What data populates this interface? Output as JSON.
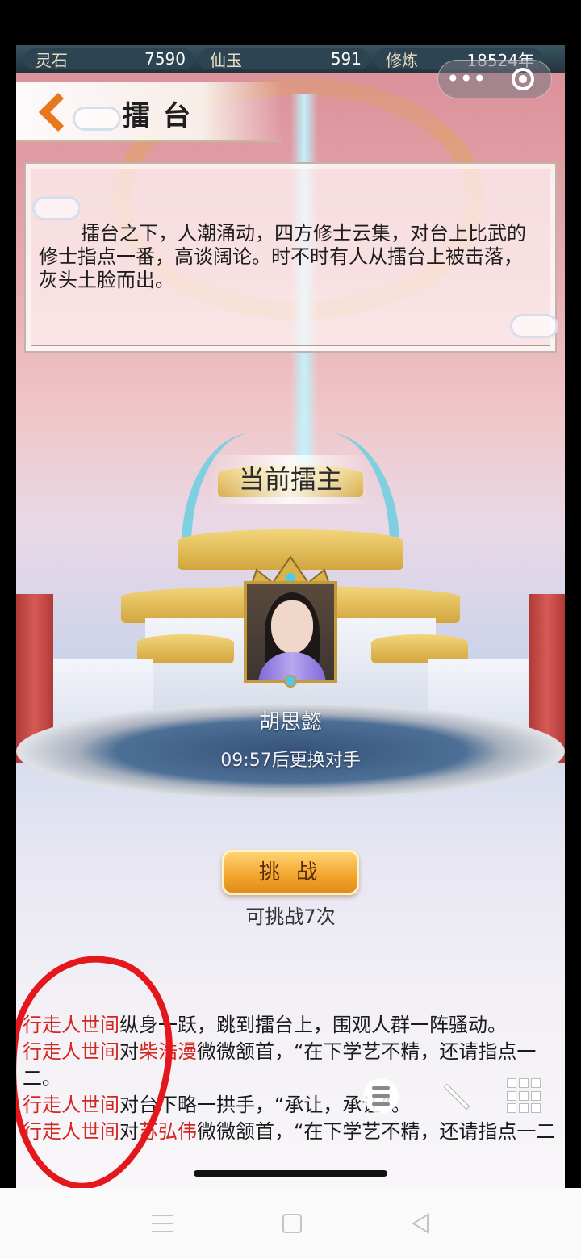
{
  "resources": [
    {
      "label": "灵石",
      "value": "7590"
    },
    {
      "label": "仙玉",
      "value": "591"
    },
    {
      "label": "修炼",
      "value": "18524年"
    }
  ],
  "capsule": {
    "more_icon": "more-dots-icon",
    "close_icon": "target-close-icon"
  },
  "header": {
    "title": "擂台",
    "back_icon": "chevron-left-icon"
  },
  "description": "擂台之下，人潮涌动，四方修士云集，对台上比武的修士指点一番，高谈阔论。时不时有人从擂台上被击落，灰头土脸而出。",
  "arena": {
    "owner_label": "当前擂主",
    "owner_name": "胡思懿",
    "timer_text": "09:57后更换对手"
  },
  "challenge": {
    "button_label": "挑 战",
    "count_text": "可挑战7次"
  },
  "log": [
    {
      "parts": [
        {
          "t": "行走人世间",
          "hl": true
        },
        {
          "t": "纵身一跃，跳到擂台上，围观人群一阵骚动。",
          "hl": false
        }
      ]
    },
    {
      "parts": [
        {
          "t": "行走人世间",
          "hl": true
        },
        {
          "t": "对",
          "hl": false
        },
        {
          "t": "柴浩漫",
          "hl": true
        },
        {
          "t": "微微颔首，“在下学艺不精，还请指点一二。",
          "hl": false
        }
      ]
    },
    {
      "parts": [
        {
          "t": "行走人世间",
          "hl": true
        },
        {
          "t": "对台下略一拱手，“承让，承让”。",
          "hl": false
        }
      ]
    },
    {
      "parts": [
        {
          "t": "行走人世间",
          "hl": true
        },
        {
          "t": "对",
          "hl": false
        },
        {
          "t": "苏弘伟",
          "hl": true
        },
        {
          "t": "微微颔首，“在下学艺不精，还请指点一二",
          "hl": false
        }
      ]
    }
  ],
  "floating": {
    "menu_icon": "hamburger-icon",
    "wand_icon": "magic-wand-icon",
    "grid_icon": "grid-icon"
  },
  "nav": {
    "recents_icon": "recents-icon",
    "home_icon": "home-icon",
    "back_icon": "back-triangle-icon"
  },
  "colors": {
    "highlight": "#d2261e",
    "button": "#f2a52b",
    "annotation": "#e4181c"
  }
}
